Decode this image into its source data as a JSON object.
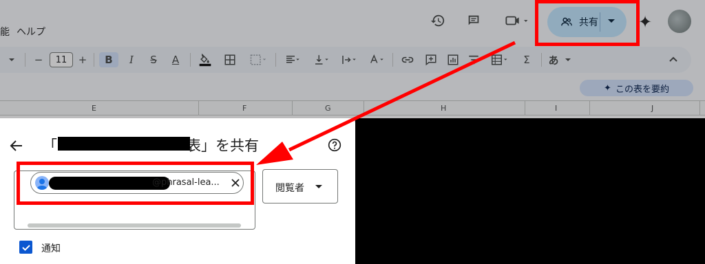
{
  "menubar": {
    "partial_item": "能",
    "help": "ヘルプ"
  },
  "topbar": {
    "share_label": "共有"
  },
  "toolbar": {
    "font_size": "11",
    "minus": "−",
    "plus": "+",
    "bold": "B",
    "italic": "I",
    "strike": "S",
    "text_color": "A",
    "sigma": "Σ",
    "input_tool": "あ"
  },
  "summarize": {
    "label": "この表を要約"
  },
  "columns": [
    "E",
    "F",
    "G",
    "H",
    "I",
    "J"
  ],
  "dialog": {
    "title_open": "「",
    "title_rest": "表」を共有",
    "chip_email": "@phrasal-lea...",
    "role": "閲覧者",
    "notify_label": "通知"
  },
  "colors": {
    "share_button_bg": "#c2e7ff",
    "annotation_red": "#ff0000",
    "checkbox_blue": "#0b57d0"
  },
  "icons": {
    "history": "history-icon",
    "comment": "comment-icon",
    "video": "video-icon",
    "person": "person-add-icon",
    "sparkle": "sparkle-icon",
    "back": "arrow-left-icon",
    "help": "help-icon",
    "close": "close-icon",
    "check": "check-icon"
  }
}
